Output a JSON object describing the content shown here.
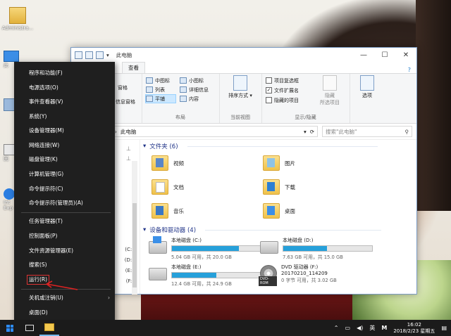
{
  "desktop": {
    "icons": [
      {
        "label": "Administra..."
      }
    ],
    "side_labels": [
      "此",
      "回",
      "Int",
      "Exp"
    ]
  },
  "explorer": {
    "title": "此电脑",
    "window_buttons": {
      "minimize": "—",
      "maximize": "☐",
      "close": "✕"
    },
    "tabs": [
      "查看"
    ],
    "help": "?",
    "ribbon": {
      "pane_partial_label": "窗格",
      "info_pane_partial_label": "信息窗格",
      "layout_items": [
        "中图标",
        "小图标",
        "列表",
        "详细信息",
        "平铺",
        "内容"
      ],
      "layout_selected": "平铺",
      "layout_group": "布局",
      "sort_label": "排序方式",
      "current_view_group": "当前视图",
      "checks": [
        {
          "label": "项目复选框",
          "checked": false
        },
        {
          "label": "文件扩展名",
          "checked": true
        },
        {
          "label": "隐藏的项目",
          "checked": false
        }
      ],
      "hide_label": "隐藏",
      "hide_label2": "所选项目",
      "options_label": "选项",
      "showhide_group": "显示/隐藏"
    },
    "address": {
      "path": "此电脑",
      "search_placeholder": "搜索\"此电脑\""
    },
    "nav_drives": [
      "(C:)",
      "(D:)",
      "(E:)",
      "(F:)"
    ],
    "folders_header": "文件夹 (6)",
    "folders": [
      "视频",
      "图片",
      "文档",
      "下载",
      "音乐",
      "桌面"
    ],
    "drives_header": "设备和驱动器 (4)",
    "drives": [
      {
        "name": "本地磁盘 (C:)",
        "free": "5.04 GB 可用，共 20.0 GB",
        "used_fraction": 0.75
      },
      {
        "name": "本地磁盘 (D:)",
        "free": "7.63 GB 可用，共 15.0 GB",
        "used_fraction": 0.49
      },
      {
        "name": "本地磁盘 (E:)",
        "free": "12.4 GB 可用，共 24.9 GB",
        "used_fraction": 0.5
      },
      {
        "name": "DVD 驱动器 (F:)",
        "sub": "20170210_114209",
        "free": "0 字节 可用，共 3.02 GB",
        "dvd_tag": "DVD-ROM"
      }
    ]
  },
  "winx_menu": {
    "items": [
      "程序和功能(F)",
      "电源选项(O)",
      "事件查看器(V)",
      "系统(Y)",
      "设备管理器(M)",
      "网络连接(W)",
      "磁盘管理(K)",
      "计算机管理(G)",
      "命令提示符(C)",
      "命令提示符(管理员)(A)",
      "任务管理器(T)",
      "控制面板(P)",
      "文件资源管理器(E)",
      "搜索(S)",
      "运行(R)",
      "关机或注销(U)",
      "桌面(D)"
    ],
    "highlighted": "运行(R)",
    "submenu_arrow": "›"
  },
  "taskbar": {
    "ime": "英",
    "ime2": "M",
    "time": "16:02",
    "date": "2018/2/23 星期五"
  },
  "colors": {
    "accent": "#26a0da",
    "menu_bg": "#1f1f1f",
    "annotation": "#dd2222"
  }
}
